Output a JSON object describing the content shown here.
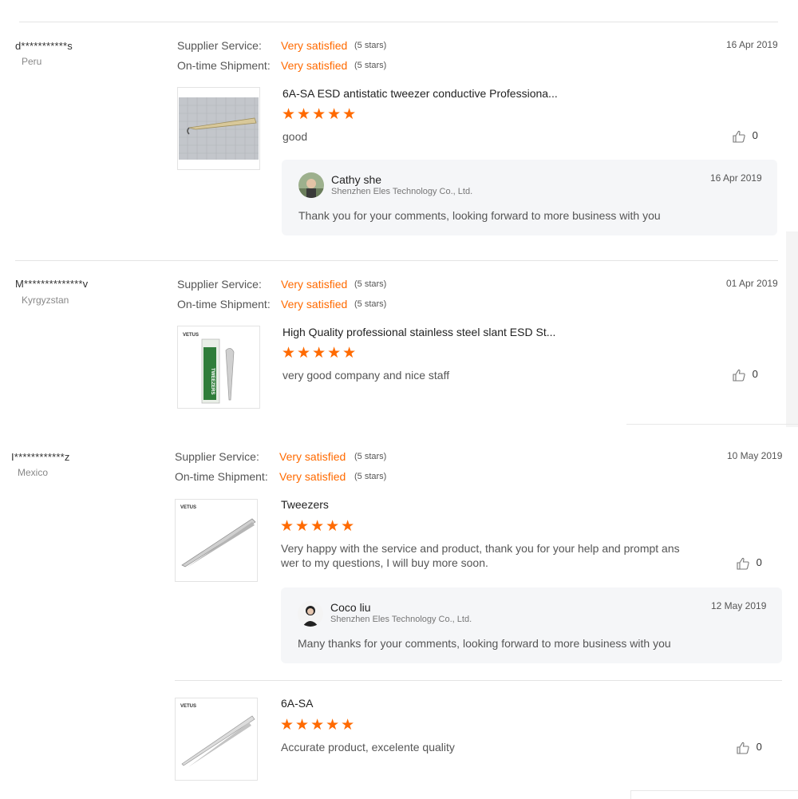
{
  "reviews": [
    {
      "buyer": "d***********s",
      "country": "Peru",
      "supplier_service_label": "Supplier Service:",
      "supplier_service_value": "Very satisfied",
      "supplier_service_stars": "(5 stars)",
      "shipment_label": "On-time Shipment:",
      "shipment_value": "Very satisfied",
      "shipment_stars": "(5 stars)",
      "date": "16 Apr 2019",
      "product_title": "6A-SA ESD antistatic tweezer conductive Professiona...",
      "rating": 5,
      "stars_glyph": "★★★★★",
      "comment": "good",
      "likes": "0",
      "reply": {
        "name": "Cathy she",
        "company": "Shenzhen Eles Technology Co., Ltd.",
        "date": "16 Apr 2019",
        "text": "Thank you for your comments, looking forward to more business with you"
      }
    },
    {
      "buyer": "M**************v",
      "country": "Kyrgyzstan",
      "supplier_service_label": "Supplier Service:",
      "supplier_service_value": "Very satisfied",
      "supplier_service_stars": "(5 stars)",
      "shipment_label": "On-time Shipment:",
      "shipment_value": "Very satisfied",
      "shipment_stars": "(5 stars)",
      "date": "01 Apr 2019",
      "product_title": "High Quality professional stainless steel slant ESD St...",
      "rating": 5,
      "stars_glyph": "★★★★★",
      "comment": "very good company and nice staff",
      "likes": "0",
      "thumb_brand": "VETUS",
      "thumb_pack_text": "TWEEZERS"
    },
    {
      "buyer": "I************z",
      "country": "Mexico",
      "supplier_service_label": "Supplier Service:",
      "supplier_service_value": "Very satisfied",
      "supplier_service_stars": "(5 stars)",
      "shipment_label": "On-time Shipment:",
      "shipment_value": "Very satisfied",
      "shipment_stars": "(5 stars)",
      "date": "10 May 2019",
      "product_title": "Tweezers",
      "rating": 5,
      "stars_glyph": "★★★★★",
      "comment_line1": "Very happy with the service and product, thank you for your help and prompt ans",
      "comment_line2": "wer to my questions, I will buy more soon.",
      "likes": "0",
      "thumb_brand": "VETUS",
      "reply": {
        "name": "Coco liu",
        "company": "Shenzhen Eles Technology Co., Ltd.",
        "date": "12 May 2019",
        "text": "Many thanks for your comments, looking forward to more business with you"
      },
      "extra_item": {
        "product_title": "6A-SA",
        "rating": 5,
        "stars_glyph": "★★★★★",
        "comment": "Accurate product, excelente quality",
        "likes": "0",
        "thumb_brand": "VETUS"
      }
    }
  ],
  "icons": {
    "like": "thumbs-up-icon",
    "star": "star-icon"
  },
  "colors": {
    "accent": "#ff6a00",
    "reply_bg": "#f5f6f8",
    "divider": "#e4e4e4"
  }
}
